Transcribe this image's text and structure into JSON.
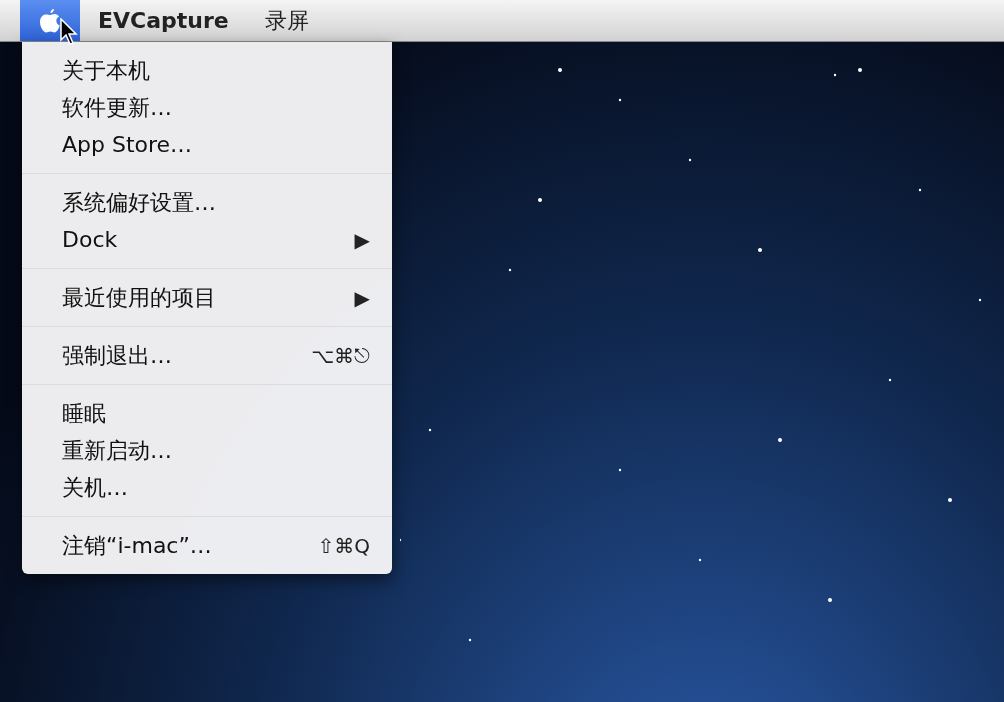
{
  "menu_bar": {
    "items": [
      {
        "kind": "apple",
        "selected": true
      },
      {
        "kind": "app",
        "label": "EVCapture",
        "selected": false
      },
      {
        "kind": "menu",
        "label": "录屏",
        "selected": false
      }
    ]
  },
  "apple_menu": {
    "groups": [
      [
        {
          "label": "关于本机"
        },
        {
          "label": "软件更新…"
        },
        {
          "label": "App Store…"
        }
      ],
      [
        {
          "label": "系统偏好设置…"
        },
        {
          "label": "Dock",
          "arrow": "▶"
        }
      ],
      [
        {
          "label": "最近使用的项目",
          "arrow": "▶"
        }
      ],
      [
        {
          "label": "强制退出…",
          "shortcut": "⌥⌘⎋"
        }
      ],
      [
        {
          "label": "睡眠"
        },
        {
          "label": "重新启动…"
        },
        {
          "label": "关机…"
        }
      ],
      [
        {
          "label": "注销“i-mac”…",
          "shortcut": "⇧⌘Q"
        }
      ]
    ]
  }
}
